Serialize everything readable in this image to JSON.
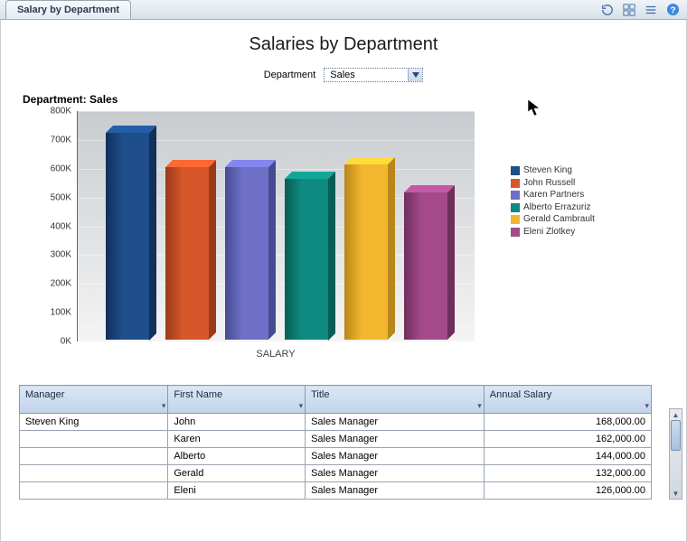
{
  "tab_label": "Salary by Department",
  "page_title": "Salaries by Department",
  "picker": {
    "label": "Department",
    "value": "Sales"
  },
  "subhead": "Department: Sales",
  "chart_data": {
    "type": "bar",
    "title": "Salaries by Department",
    "xlabel": "SALARY",
    "ylabel": "",
    "ylim": [
      0,
      800000
    ],
    "y_ticks": [
      "0K",
      "100K",
      "200K",
      "300K",
      "400K",
      "500K",
      "600K",
      "700K",
      "800K"
    ],
    "categories": [
      "Steven King",
      "John Russell",
      "Karen Partners",
      "Alberto Errazuriz",
      "Gerald Cambrault",
      "Eleni Zlotkey"
    ],
    "values": [
      720000,
      600000,
      600000,
      560000,
      610000,
      510000
    ],
    "colors": [
      "#1f4e8c",
      "#d8572a",
      "#6d70c6",
      "#0f8a80",
      "#f3b72f",
      "#a44a8a"
    ],
    "colors_dark": [
      "#12305a",
      "#9a3a1a",
      "#474a93",
      "#075e56",
      "#b8861a",
      "#6e2f5c"
    ]
  },
  "legend": [
    {
      "label": "Steven King",
      "color": "#1f4e8c"
    },
    {
      "label": "John Russell",
      "color": "#d8572a"
    },
    {
      "label": "Karen Partners",
      "color": "#6d70c6"
    },
    {
      "label": "Alberto Errazuriz",
      "color": "#0f8a80"
    },
    {
      "label": "Gerald Cambrault",
      "color": "#f3b72f"
    },
    {
      "label": "Eleni Zlotkey",
      "color": "#a44a8a"
    }
  ],
  "table": {
    "columns": [
      "Manager",
      "First Name",
      "Title",
      "Annual Salary"
    ],
    "rows": [
      {
        "manager": "Steven King",
        "first": "John",
        "title": "Sales Manager",
        "salary": "168,000.00"
      },
      {
        "manager": "",
        "first": "Karen",
        "title": "Sales Manager",
        "salary": "162,000.00"
      },
      {
        "manager": "",
        "first": "Alberto",
        "title": "Sales Manager",
        "salary": "144,000.00"
      },
      {
        "manager": "",
        "first": "Gerald",
        "title": "Sales Manager",
        "salary": "132,000.00"
      },
      {
        "manager": "",
        "first": "Eleni",
        "title": "Sales Manager",
        "salary": "126,000.00"
      }
    ]
  }
}
